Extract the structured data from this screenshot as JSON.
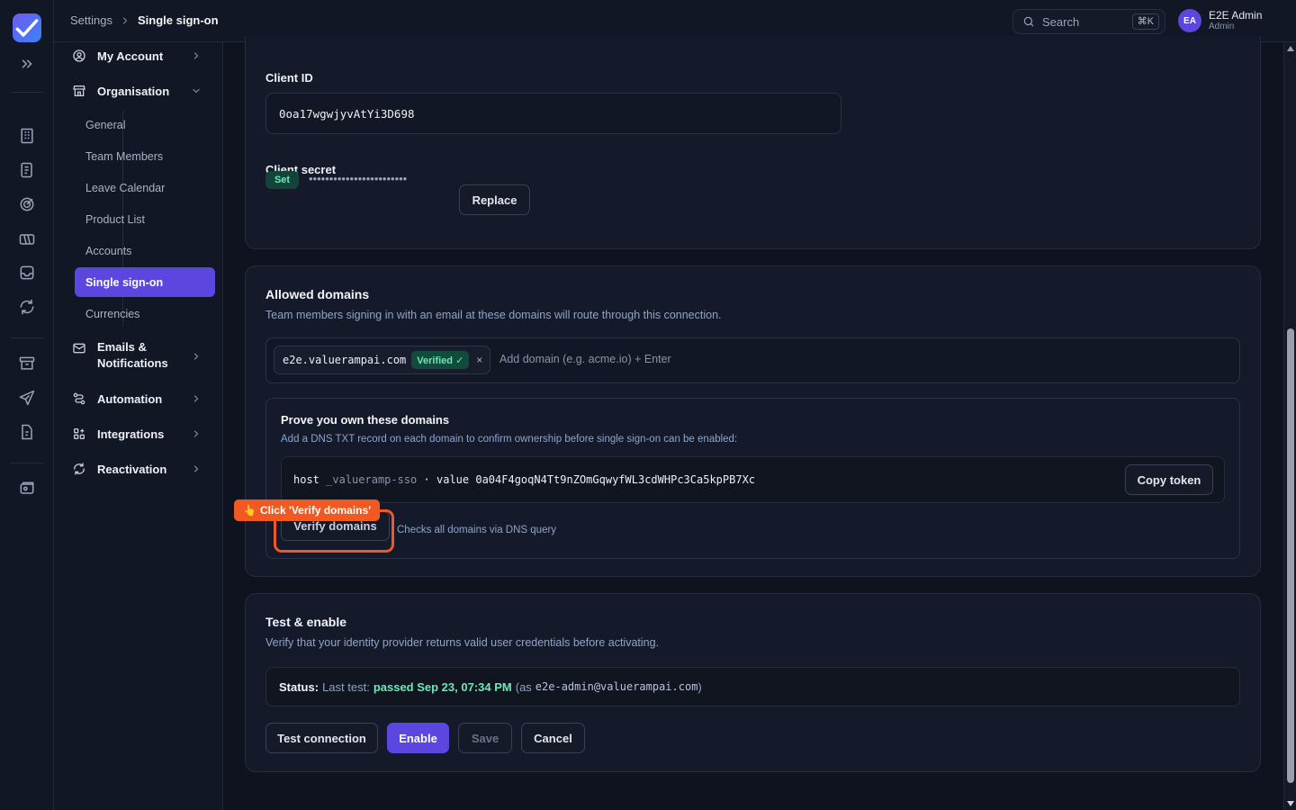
{
  "breadcrumb": {
    "parent": "Settings",
    "current": "Single sign-on"
  },
  "search": {
    "placeholder": "Search",
    "shortcut": "⌘K"
  },
  "user": {
    "initials": "EA",
    "name": "E2E Admin",
    "role": "Admin"
  },
  "sidebar": {
    "my_account": "My Account",
    "organisation": "Organisation",
    "org_items": [
      "General",
      "Team Members",
      "Leave Calendar",
      "Product List",
      "Accounts",
      "Single sign-on",
      "Currencies"
    ],
    "active_item": "Single sign-on",
    "emails_line1": "Emails &",
    "emails_line2": "Notifications",
    "automation": "Automation",
    "integrations": "Integrations",
    "reactivation": "Reactivation"
  },
  "credentials": {
    "client_id_label": "Client ID",
    "client_id_value": "0oa17wgwjyvAtYi3D698",
    "client_secret_label": "Client secret",
    "secret_badge": "Set",
    "secret_mask": "••••••••••••••••••••••••",
    "replace_button": "Replace"
  },
  "domains": {
    "title": "Allowed domains",
    "description": "Team members signing in with an email at these domains will route through this connection.",
    "chips": [
      {
        "domain": "e2e.valuerampai.com",
        "status": "Verified ✓"
      }
    ],
    "remove_glyph": "×",
    "add_placeholder": "Add domain (e.g. acme.io) + Enter",
    "prove": {
      "title": "Prove you own these domains",
      "description": "Add a DNS TXT record on each domain to confirm ownership before single sign-on can be enabled:",
      "host_label": "host",
      "host_value": "_valueramp-sso",
      "separator": "·",
      "value_label": "value",
      "token": "0a04F4goqN4Tt9nZOmGqwyfWL3cdWHPc3Ca5kpPB7Xc",
      "copy_button": "Copy token",
      "verify_button": "Verify domains",
      "verify_hint": "Checks all domains via DNS query"
    }
  },
  "tooltip": {
    "icon": "👆",
    "text": "Click 'Verify domains'"
  },
  "test": {
    "title": "Test & enable",
    "description": "Verify that your identity provider returns valid user credentials before activating.",
    "status_label": "Status:",
    "last_test": "Last test:",
    "result": "passed Sep 23, 07:34 PM",
    "as_open": "(as",
    "email": "e2e-admin@valuerampai.com",
    "as_close": ")",
    "buttons": {
      "test": "Test connection",
      "enable": "Enable",
      "save": "Save",
      "cancel": "Cancel"
    }
  },
  "colors": {
    "accent": "#5b47e0",
    "highlight": "#f05a22",
    "success": "#6ee7b7"
  }
}
